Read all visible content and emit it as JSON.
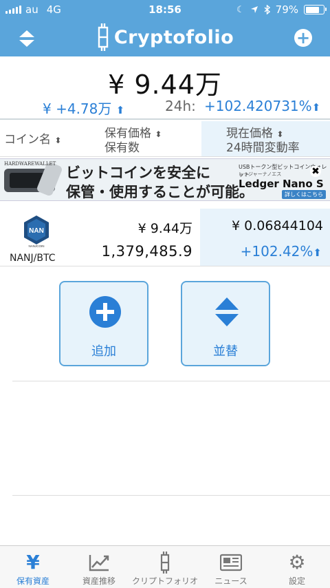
{
  "status_bar": {
    "carrier": "au",
    "network": "4G",
    "time": "18:56",
    "battery": "79%",
    "battery_level": 0.79
  },
  "nav": {
    "title": "Cryptofolio"
  },
  "summary": {
    "total": "¥ 9.44万",
    "change_amount": "¥ +4.78万",
    "change_24h_label": "24h:",
    "change_24h": "+102.420731%"
  },
  "table_header": {
    "coin_name": "コイン名",
    "holding_price": "保有価格",
    "holding_qty": "保有数",
    "current_price": "現在価格",
    "change_rate": "24時間変動率"
  },
  "ad": {
    "brand": "HARDWAREWALLET",
    "line1": "ビットコインを安全に",
    "line2": "保管・使用することが可能。",
    "small1": "USBトークン型ビットコインウォレット",
    "small2": "レッジャーナノエス",
    "product": "Ledger Nano S",
    "cta": "詳しくはこちら"
  },
  "holdings": [
    {
      "logo_text": "NAN",
      "logo_sub": "NANJCOIN",
      "pair": "NANJ/BTC",
      "holding_price": "¥ 9.44万",
      "holding_qty": "1,379,485.9",
      "current_price": "¥ 0.06844104",
      "change_rate": "+102.42%"
    }
  ],
  "actions": {
    "add": "追加",
    "sort": "並替"
  },
  "tabs": [
    {
      "label": "保有資産",
      "icon": "yen-icon",
      "active": true
    },
    {
      "label": "資産推移",
      "icon": "chart-icon",
      "active": false
    },
    {
      "label": "クリプトフォリオ",
      "icon": "bitcoin-icon",
      "active": false
    },
    {
      "label": "ニュース",
      "icon": "newspaper-icon",
      "active": false
    },
    {
      "label": "設定",
      "icon": "gear-icon",
      "active": false
    }
  ],
  "colors": {
    "primary": "#5aa5db",
    "accent": "#2a7fd6",
    "highlight": "#e8f3fb"
  }
}
